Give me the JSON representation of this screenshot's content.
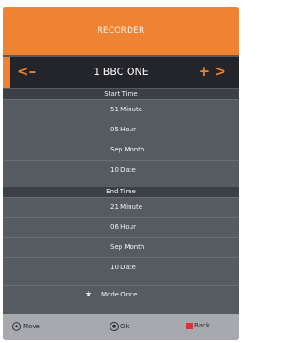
{
  "title": "RECORDER",
  "channel": {
    "name": "1 BBC ONE",
    "prev_icon": "arrow-left",
    "next_icon": "arrow-right",
    "prev_label": "<–",
    "next_label": "+ >"
  },
  "start_time": {
    "header": "Start Time",
    "rows": [
      {
        "label": "51 Minute"
      },
      {
        "label": "05 Hour"
      },
      {
        "label": "Sep  Month"
      },
      {
        "label": "10 Date"
      }
    ]
  },
  "end_time": {
    "header": "End Time",
    "rows": [
      {
        "label": "21 Minute"
      },
      {
        "label": "06 Hour"
      },
      {
        "label": "Sep  Month"
      },
      {
        "label": "10 Date"
      }
    ]
  },
  "mode": {
    "label": "Mode Once",
    "icon": "star"
  },
  "hints": {
    "move": "Move",
    "ok": "Ok",
    "back": "Back"
  },
  "colors": {
    "accent": "#f08234",
    "panel": "#565a61",
    "channel_bar": "#24252a",
    "back_key": "#e0303a"
  }
}
